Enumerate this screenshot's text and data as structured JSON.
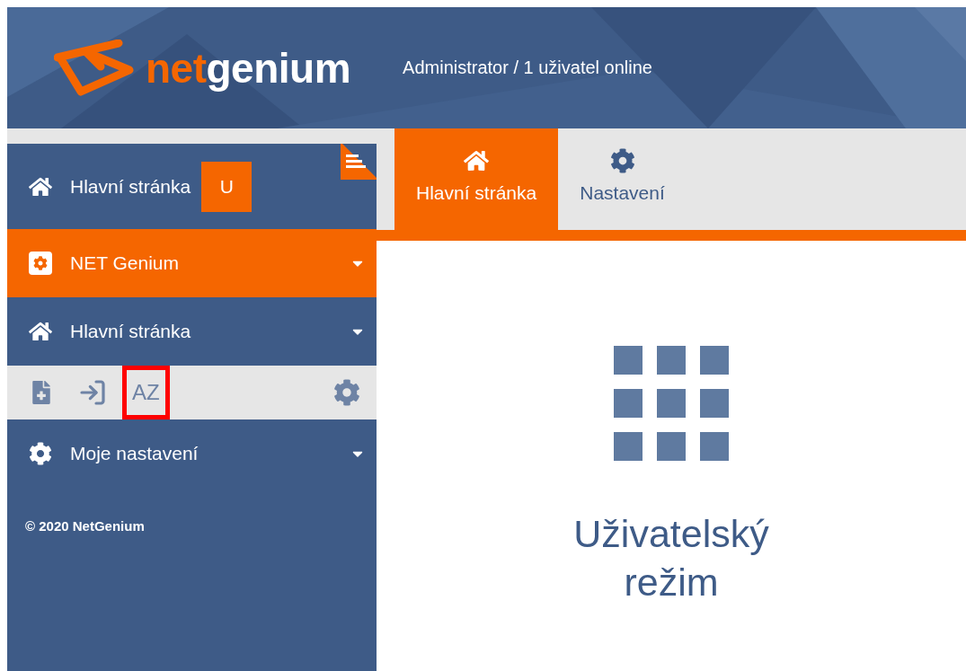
{
  "header": {
    "logo": {
      "part_1": "net",
      "part_2": "genium"
    },
    "user_info": "Administrator / 1 uživatel online"
  },
  "sidebar": {
    "home": {
      "label": "Hlavní stránka",
      "badge": "U"
    },
    "menu": [
      {
        "label": "NET Genium",
        "kind": "app",
        "selected": true
      },
      {
        "label": "Hlavní stránka",
        "kind": "home",
        "selected": false
      }
    ],
    "toolbar": [
      {
        "kind": "add-page",
        "highlighted": false
      },
      {
        "kind": "import",
        "highlighted": false
      },
      {
        "kind": "sort",
        "label": "AZ",
        "highlighted": true
      }
    ],
    "menu_after": [
      {
        "label": "Moje nastavení",
        "kind": "settings",
        "selected": false
      }
    ],
    "copyright": "© 2020 NetGenium"
  },
  "tabs": [
    {
      "label": "Hlavní stránka",
      "kind": "home",
      "selected": true
    },
    {
      "label": "Nastavení",
      "kind": "settings",
      "selected": false
    }
  ],
  "content": {
    "title": "Uživatelský režim"
  }
}
